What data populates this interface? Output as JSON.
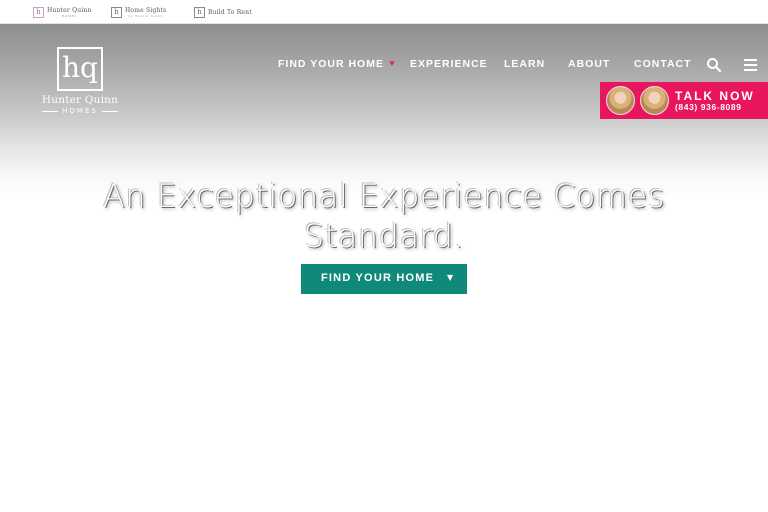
{
  "top_brands": [
    {
      "name": "Hunter Quinn",
      "sub": "HOMES",
      "icon": "hq-logo-icon"
    },
    {
      "name": "Home Sights",
      "sub": "by Hunter Quinn",
      "icon": "hq-logo-icon"
    },
    {
      "name": "Build To Rent",
      "icon": "hq-logo-icon"
    }
  ],
  "logo": {
    "mark": "hq",
    "name": "Hunter Quinn",
    "sub": "HOMES"
  },
  "nav": {
    "items": [
      {
        "label": "FIND YOUR HOME",
        "has_dropdown": true
      },
      {
        "label": "EXPERIENCE"
      },
      {
        "label": "LEARN"
      },
      {
        "label": "ABOUT"
      },
      {
        "label": "CONTACT"
      }
    ],
    "caret_color": "#e6185a",
    "search_icon": "search-icon",
    "menu_icon": "hamburger-menu-icon"
  },
  "talk_now": {
    "title": "TALK NOW",
    "phone": "(843) 936-8089",
    "bg": "#e8175d"
  },
  "hero": {
    "headline": "An Exceptional Experience Comes Standard.",
    "cta_label": "FIND YOUR HOME",
    "cta_color": "#0f8a7a"
  }
}
